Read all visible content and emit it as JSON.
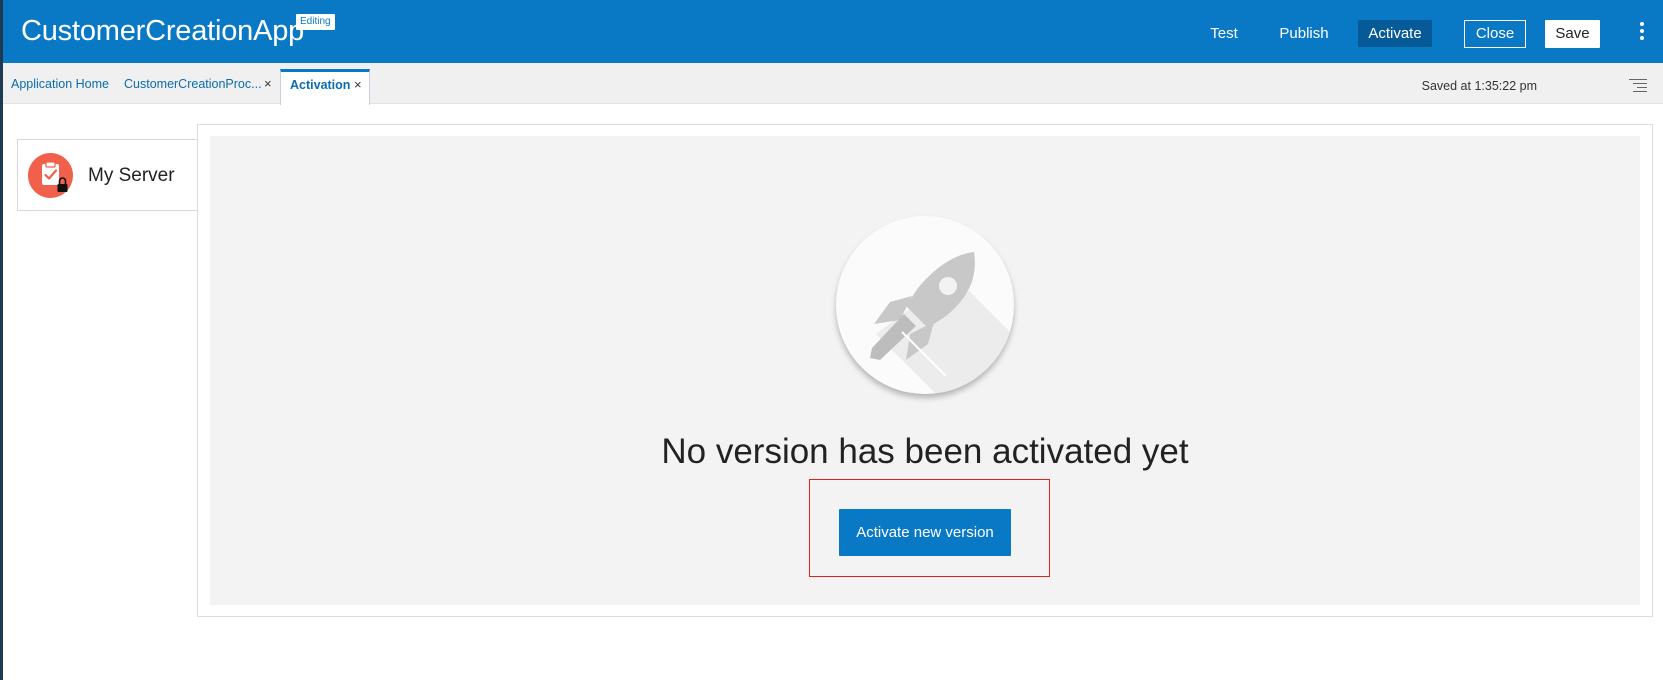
{
  "header": {
    "app_title": "CustomerCreationApp",
    "badge": "Editing",
    "actions": {
      "test": "Test",
      "publish": "Publish",
      "activate": "Activate",
      "close": "Close",
      "save": "Save"
    },
    "more_icon": "kebab-menu-icon"
  },
  "tabs": [
    {
      "label": "Application Home",
      "closable": false,
      "active": false
    },
    {
      "label": "CustomerCreationProc...",
      "closable": true,
      "active": false
    },
    {
      "label": "Activation",
      "closable": true,
      "active": true
    }
  ],
  "tab_close_glyph": "×",
  "status": {
    "saved_text": "Saved at 1:35:22 pm",
    "list_icon": "list-menu-icon"
  },
  "server": {
    "name": "My Server",
    "icon": "clipboard-check-lock-icon"
  },
  "empty_state": {
    "illustration": "rocket-icon",
    "message": "No version has been activated yet",
    "button_label": "Activate new version"
  },
  "colors": {
    "brand": "#0a79c5",
    "server_icon": "#f0604a",
    "highlight": "#d92222"
  }
}
